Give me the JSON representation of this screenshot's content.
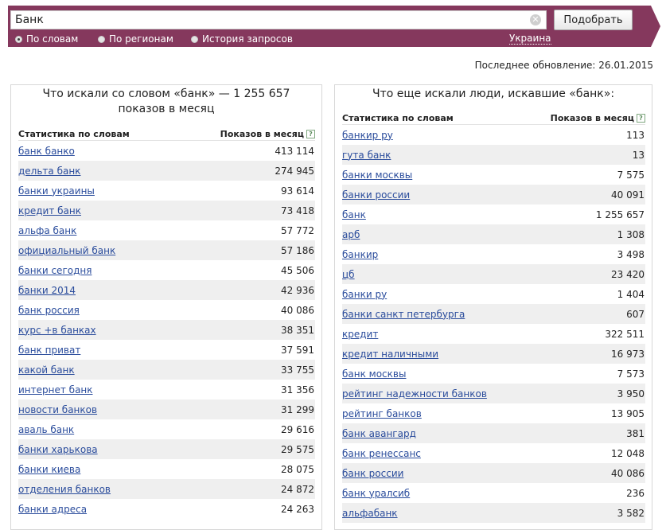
{
  "search": {
    "query": "Банк",
    "submit_label": "Подобрать",
    "clear_symbol": "✕"
  },
  "modes": [
    {
      "label": "По словам",
      "checked": true
    },
    {
      "label": "По регионам",
      "checked": false
    },
    {
      "label": "История запросов",
      "checked": false
    }
  ],
  "region": "Украина",
  "last_updated": "Последнее обновление: 26.01.2015",
  "left_panel": {
    "title": "Что искали со словом «банк» — 1 255 657 показов в месяц",
    "col_keyword": "Статистика по словам",
    "col_count": "Показов в месяц",
    "help": "?",
    "rows": [
      {
        "keyword": "банк банко",
        "count": "413 114"
      },
      {
        "keyword": "дельта банк",
        "count": "274 945"
      },
      {
        "keyword": "банки украины",
        "count": "93 614"
      },
      {
        "keyword": "кредит банк",
        "count": "73 418"
      },
      {
        "keyword": "альфа банк",
        "count": "57 772"
      },
      {
        "keyword": "официальный банк",
        "count": "57 186"
      },
      {
        "keyword": "банки сегодня",
        "count": "45 506"
      },
      {
        "keyword": "банки 2014",
        "count": "42 936"
      },
      {
        "keyword": "банк россия",
        "count": "40 086"
      },
      {
        "keyword": "курс +в банках",
        "count": "38 351"
      },
      {
        "keyword": "банк приват",
        "count": "37 591"
      },
      {
        "keyword": "какой банк",
        "count": "33 755"
      },
      {
        "keyword": "интернет банк",
        "count": "31 356"
      },
      {
        "keyword": "новости банков",
        "count": "31 299"
      },
      {
        "keyword": "аваль банк",
        "count": "29 616"
      },
      {
        "keyword": "банки харькова",
        "count": "29 575"
      },
      {
        "keyword": "банки киева",
        "count": "28 075"
      },
      {
        "keyword": "отделения банков",
        "count": "24 872"
      },
      {
        "keyword": "банки адреса",
        "count": "24 263"
      }
    ]
  },
  "right_panel": {
    "title": "Что еще искали люди, искавшие «банк»:",
    "col_keyword": "Статистика по словам",
    "col_count": "Показов в месяц",
    "help": "?",
    "rows": [
      {
        "keyword": "банкир ру",
        "count": "113"
      },
      {
        "keyword": "гута банк",
        "count": "13"
      },
      {
        "keyword": "банки москвы",
        "count": "7 575"
      },
      {
        "keyword": "банки россии",
        "count": "40 091"
      },
      {
        "keyword": "банк",
        "count": "1 255 657"
      },
      {
        "keyword": "арб",
        "count": "1 308"
      },
      {
        "keyword": "банкир",
        "count": "3 498"
      },
      {
        "keyword": "цб",
        "count": "23 420"
      },
      {
        "keyword": "банки ру",
        "count": "1 404"
      },
      {
        "keyword": "банки санкт петербурга",
        "count": "607"
      },
      {
        "keyword": "кредит",
        "count": "322 511"
      },
      {
        "keyword": "кредит наличными",
        "count": "16 973"
      },
      {
        "keyword": "банк москвы",
        "count": "7 573"
      },
      {
        "keyword": "рейтинг надежности банков",
        "count": "3 950"
      },
      {
        "keyword": "рейтинг банков",
        "count": "13 905"
      },
      {
        "keyword": "банк авангард",
        "count": "381"
      },
      {
        "keyword": "банк ренессанс",
        "count": "12 048"
      },
      {
        "keyword": "банк россии",
        "count": "40 086"
      },
      {
        "keyword": "банк уралсиб",
        "count": "236"
      },
      {
        "keyword": "альфабанк",
        "count": "3 582"
      }
    ]
  }
}
